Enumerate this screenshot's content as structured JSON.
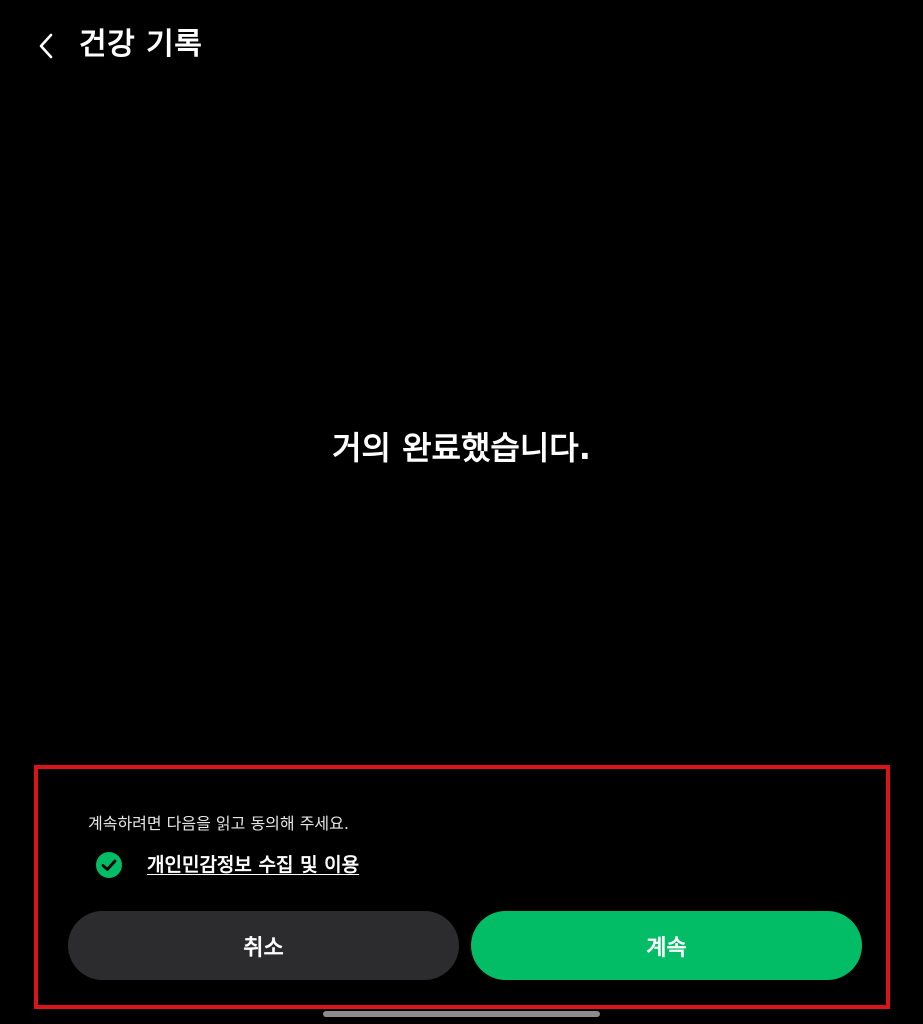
{
  "header": {
    "title": "건강 기록",
    "back_icon": "chevron-left-icon"
  },
  "main": {
    "headline": "거의 완료했습니다."
  },
  "consent": {
    "instruction": "계속하려면 다음을 읽고 동의해 주세요.",
    "item_label": "개인민감정보 수집 및 이용",
    "item_checked": true,
    "check_icon": "check-circle-icon"
  },
  "buttons": {
    "cancel_label": "취소",
    "continue_label": "계속"
  },
  "colors": {
    "background": "#000000",
    "accent_green": "#02bd66",
    "cancel_button": "#2c2c2e",
    "highlight_border": "#d8151a"
  }
}
